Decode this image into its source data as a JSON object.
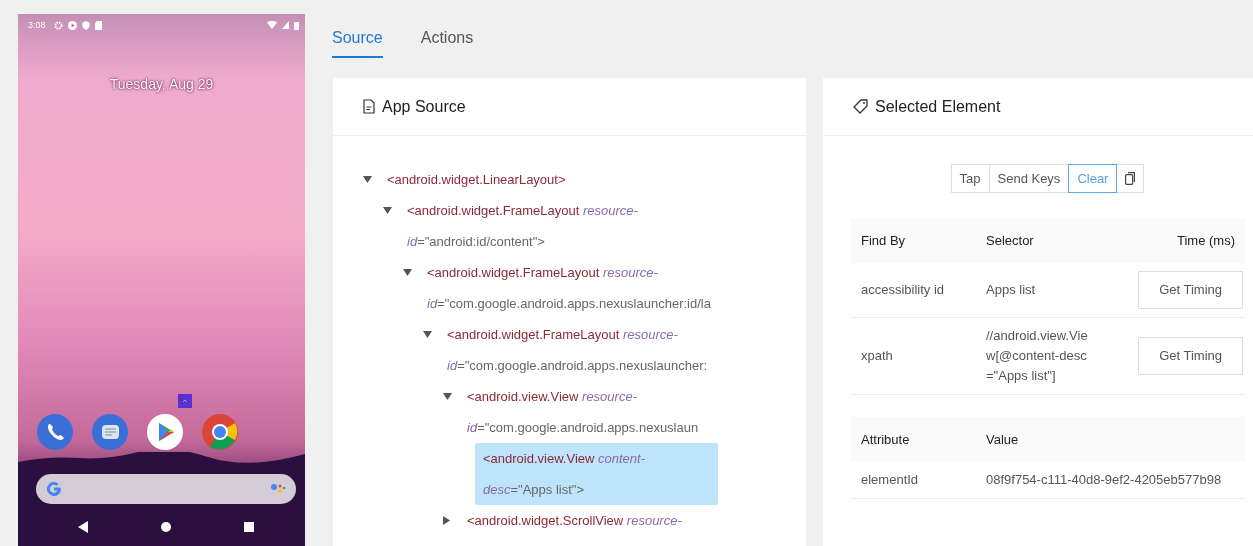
{
  "device": {
    "status_time": "3:08",
    "date": "Tuesday, Aug 29"
  },
  "tabs": [
    {
      "label": "Source",
      "selected": true
    },
    {
      "label": "Actions",
      "selected": false
    }
  ],
  "source_panel": {
    "title": "App Source",
    "tree": [
      {
        "kind": "branch",
        "expanded": true,
        "selected": false,
        "tag": "<android.widget.LinearLayout>",
        "children": [
          {
            "kind": "branch",
            "expanded": true,
            "selected": false,
            "tag": "<android.widget.FrameLayout",
            "attr": "resource-id",
            "value": "=\"android:id/content\">",
            "children": [
              {
                "kind": "branch",
                "expanded": true,
                "selected": false,
                "tag": "<android.widget.FrameLayout",
                "attr": "resource-id",
                "value": "=\"com.google.android.apps.nexuslauncher:id/la",
                "children": [
                  {
                    "kind": "branch",
                    "expanded": true,
                    "selected": false,
                    "tag": "<android.widget.FrameLayout",
                    "attr": "resource-id",
                    "value": "=\"com.google.android.apps.nexuslauncher:",
                    "children": [
                      {
                        "kind": "branch",
                        "expanded": true,
                        "selected": false,
                        "tag": "<android.view.View",
                        "attr": "resource-id",
                        "value": "=\"com.google.android.apps.nexuslaun",
                        "children": [
                          {
                            "kind": "leaf",
                            "selected": true,
                            "tag": "<android.view.View",
                            "attr": "content-desc",
                            "value": "=\"Apps list\">"
                          }
                        ]
                      },
                      {
                        "kind": "branch",
                        "expanded": false,
                        "selected": false,
                        "tag": "<android.widget.ScrollView",
                        "attr": "resource-"
                      }
                    ]
                  }
                ]
              }
            ]
          }
        ]
      }
    ]
  },
  "selected_element": {
    "title": "Selected Element",
    "actions": [
      {
        "label": "Tap",
        "selected": false
      },
      {
        "label": "Send Keys",
        "selected": false
      },
      {
        "label": "Clear",
        "selected": true
      }
    ],
    "find_by": {
      "columns": [
        "Find By",
        "Selector",
        "Time (ms)"
      ],
      "rows": [
        {
          "find_by": "accessibility id",
          "selector": "Apps list",
          "button": "Get Timing"
        },
        {
          "find_by": "xpath",
          "selector": "//android.view.View[@content-desc=\"Apps list\"]",
          "button": "Get Timing"
        }
      ]
    },
    "attributes": {
      "columns": [
        "Attribute",
        "Value"
      ],
      "rows": [
        {
          "attribute": "elementId",
          "value": "08f9f754-c111-40d8-9ef2-4205eb577b98"
        }
      ]
    }
  }
}
